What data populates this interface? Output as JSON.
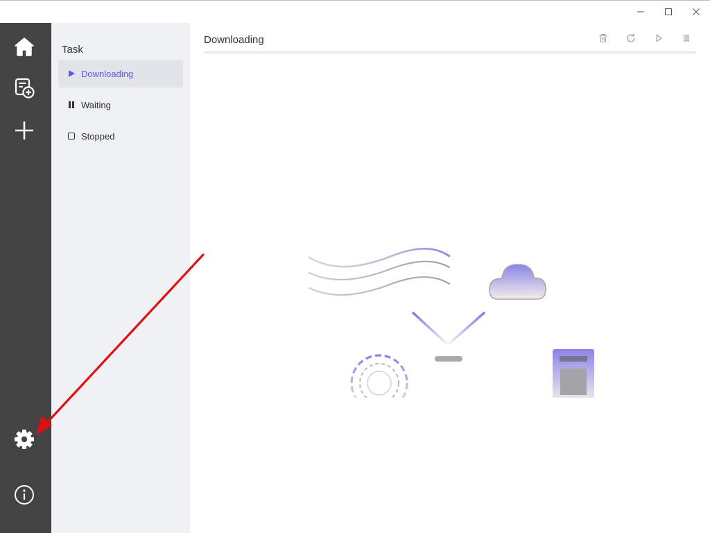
{
  "window": {
    "controls": {
      "minimize_icon": "minimize-icon",
      "maximize_icon": "maximize-icon",
      "close_icon": "close-icon"
    }
  },
  "rail": {
    "items": [
      {
        "id": "home",
        "icon": "home-icon"
      },
      {
        "id": "new-task",
        "icon": "task-add-icon"
      },
      {
        "id": "add",
        "icon": "plus-icon"
      },
      {
        "id": "settings",
        "icon": "gear-icon"
      },
      {
        "id": "about",
        "icon": "info-icon"
      }
    ]
  },
  "sidebar": {
    "title": "Task",
    "items": [
      {
        "label": "Downloading",
        "icon": "play-icon",
        "active": true
      },
      {
        "label": "Waiting",
        "icon": "pause-icon",
        "active": false
      },
      {
        "label": "Stopped",
        "icon": "stop-icon",
        "active": false
      }
    ]
  },
  "main": {
    "title": "Downloading",
    "toolbar": [
      {
        "id": "delete",
        "icon": "trash-icon"
      },
      {
        "id": "refresh",
        "icon": "refresh-icon"
      },
      {
        "id": "resume-all",
        "icon": "play-outline-icon"
      },
      {
        "id": "pause-all",
        "icon": "pause-outline-icon"
      }
    ],
    "empty_state_icon": "no-task-illustration"
  },
  "colors": {
    "rail_bg": "#434343",
    "sidebar_bg": "#f0f1f5",
    "accent": "#5b5bea",
    "annotation": "#e01010"
  }
}
